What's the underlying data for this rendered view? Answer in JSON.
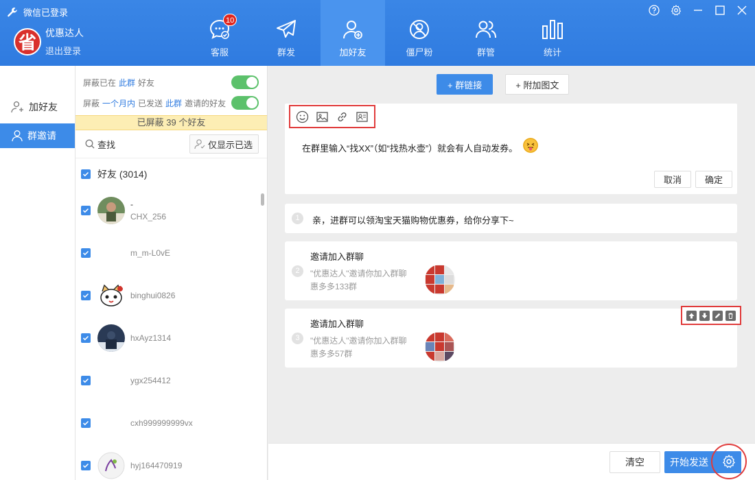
{
  "app": {
    "login_status": "微信已登录",
    "username": "优惠达人",
    "logout": "退出登录",
    "logo_char": "省"
  },
  "nav": {
    "tabs": [
      {
        "label": "客服",
        "badge": "10"
      },
      {
        "label": "群发"
      },
      {
        "label": "加好友",
        "active": true
      },
      {
        "label": "僵尸粉"
      },
      {
        "label": "群管"
      },
      {
        "label": "统计"
      }
    ]
  },
  "sidebar": {
    "items": [
      {
        "label": "加好友"
      },
      {
        "label": "群邀请",
        "active": true
      }
    ]
  },
  "filters": {
    "row1": {
      "prefix": "屏蔽已在",
      "link": "此群",
      "suffix": "好友",
      "enabled": true
    },
    "row2": {
      "prefix": "屏蔽",
      "link1": "一个月内",
      "middle": "已发送",
      "link2": "此群",
      "suffix": "邀请的好友",
      "enabled": true
    },
    "blocked_notice": "已屏蔽 39 个好友"
  },
  "search": {
    "label": "查找",
    "show_selected": "仅显示已选"
  },
  "friends": {
    "group_label": "好友 (3014)",
    "list": [
      {
        "nick": "-",
        "wxid": "CHX_256",
        "checked": true
      },
      {
        "nick": "",
        "wxid": "m_m-L0vE",
        "checked": true
      },
      {
        "nick": "",
        "wxid": "binghui0826",
        "checked": true
      },
      {
        "nick": "",
        "wxid": "hxAyz1314",
        "checked": true
      },
      {
        "nick": "",
        "wxid": "ygx254412",
        "checked": true
      },
      {
        "nick": "",
        "wxid": "cxh999999999vx",
        "checked": true
      },
      {
        "nick": "",
        "wxid": "hyj164470919",
        "checked": true
      }
    ]
  },
  "main": {
    "btn_group_link": "+ 群链接",
    "btn_attach": "+ 附加图文",
    "editor_text": "在群里输入“找XX”（如“找热水壶”）就会有人自动发券。",
    "cancel": "取消",
    "confirm": "确定",
    "messages": [
      {
        "num": "1",
        "text": "亲，进群可以领淘宝天猫购物优惠券，给你分享下~"
      },
      {
        "num": "2",
        "title": "邀请加入群聊",
        "desc1": "\"优惠达人\"邀请你加入群聊",
        "desc2": "惠多多133群"
      },
      {
        "num": "3",
        "title": "邀请加入群聊",
        "desc1": "\"优惠达人\"邀请你加入群聊",
        "desc2": "惠多多57群"
      }
    ]
  },
  "bottom": {
    "clear": "清空",
    "send": "开始发送"
  },
  "colors": {
    "header": "#3a86e6",
    "primary": "#3d8be8",
    "toggle_on": "#5cc16b",
    "highlight": "#e03a3a",
    "notice_bg": "#fdeeb4"
  }
}
